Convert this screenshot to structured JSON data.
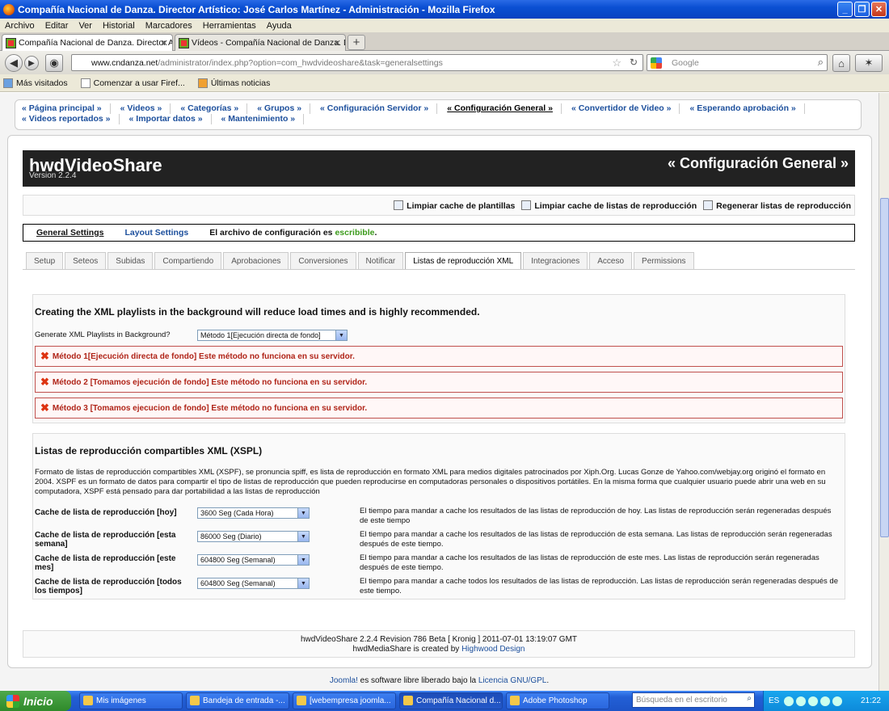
{
  "window": {
    "title": "Compañía Nacional de Danza. Director Artístico: José Carlos Martínez - Administración - Mozilla Firefox",
    "min_label": "_",
    "max_label": "❐",
    "close_label": "✕"
  },
  "menubar": [
    "Archivo",
    "Editar",
    "Ver",
    "Historial",
    "Marcadores",
    "Herramientas",
    "Ayuda"
  ],
  "browser_tabs": [
    {
      "label": "Compañía Nacional de Danza. Director Ar...",
      "close": "✕"
    },
    {
      "label": "Vídeos - Compañía Nacional de Danza. Di...",
      "close": "✕"
    }
  ],
  "new_tab_label": "+",
  "nav": {
    "url_domain": "www.cndanza.net",
    "url_path": "/administrator/index.php?option=com_hwdvideoshare&task=generalsettings",
    "search_placeholder": "Google"
  },
  "bookmarks": [
    "Más visitados",
    "Comenzar a usar Firef...",
    "Últimas noticias"
  ],
  "submenu": [
    "« Página principal »",
    "« Videos »",
    "« Categorías »",
    "« Grupos »",
    "« Configuración Servidor »",
    "« Configuración General »",
    "« Convertidor de Video »",
    "« Esperando aprobación »",
    "« Videos reportados »",
    "« Importar datos »",
    "« Mantenimiento »"
  ],
  "header": {
    "logo": "hwdVideoShare",
    "version": "Version 2.2.4",
    "title": "« Configuración General »"
  },
  "toolbar": {
    "clear_templates": "Limpiar cache de plantillas",
    "clear_playlists": "Limpiar cache de listas de reproducción",
    "regen_playlists": "Regenerar listas de reproducción"
  },
  "settings_bar": {
    "general": "General Settings",
    "layout": "Layout Settings",
    "config_text": "El archivo de configuración es",
    "writable": "escribible",
    "period": "."
  },
  "content_tabs": [
    "Setup",
    "Seteos",
    "Subidas",
    "Compartiendo",
    "Aprobaciones",
    "Conversiones",
    "Notificar",
    "Listas de reproducción XML",
    "Integraciones",
    "Acceso",
    "Permissions"
  ],
  "section1": {
    "heading": "Creating the XML playlists in the background will reduce load times and is highly recommended.",
    "label": "Generate XML Playlists in Background?",
    "select_value": "Método 1[Ejecución directa de fondo]",
    "errors": [
      "Método 1[Ejecución directa de fondo] Este método no funciona en su servidor.",
      "Método 2 [Tomamos ejecución de fondo] Este método no funciona en su servidor.",
      "Método 3 [Tomamos ejecucion de fondo] Este método no funciona en su servidor."
    ]
  },
  "section2": {
    "heading": "Listas de reproducción compartibles XML (XSPL)",
    "description": "Formato de listas de reproducción compartibles XML (XSPF), se pronuncia spiff, es lista de reproducción en formato XML para medios digitales patrocinados por Xiph.Org. Lucas Gonze de Yahoo.com/webjay.org originó el formato en 2004. XSPF es un formato de datos para compartir el tipo de listas de reproducción que pueden reproducirse en computadoras personales o dispositivos portátiles. En la misma forma que cualquier usuario puede abrir una web en su computadora, XSPF está pensado para dar portabilidad a las listas de reproducción",
    "rows": [
      {
        "label": "Cache de lista de reproducción [hoy]",
        "value": "3600 Seg (Cada Hora)",
        "help": "El tiempo para mandar a cache los resultados de las listas de reproducción de hoy. Las listas de reproducción serán regeneradas después de este tiempo"
      },
      {
        "label": "Cache de lista de reproducción [esta semana]",
        "value": "86000 Seg (Diario)",
        "help": "El tiempo para mandar a cache los resultados de las listas de reproducción de esta semana. Las listas de reproducción serán regeneradas después de este tiempo."
      },
      {
        "label": "Cache de lista de reproducción [este mes]",
        "value": "604800 Seg (Semanal)",
        "help": "El tiempo para mandar a cache los resultados de las listas de reproducción de este mes. Las listas de reproducción serán regeneradas después de este tiempo."
      },
      {
        "label": "Cache de lista de reproducción [todos los tiempos]",
        "value": "604800 Seg (Semanal)",
        "help": "El tiempo para mandar a cache todos los resultados de las listas de reproducción. Las listas de reproducción serán regeneradas después de este tiempo."
      }
    ]
  },
  "footer": {
    "line1": "hwdVideoShare 2.2.4 Revision 786 Beta [ Kronig ] 2011-07-01 13:19:07 GMT",
    "line2_pre": "hwdMediaShare is created by",
    "line2_link": "Highwood Design"
  },
  "joomla": {
    "link1": "Joomla!",
    "text": "es software libre liberado bajo la",
    "link2": "Licencia GNU/GPL",
    "period": "."
  },
  "taskbar": {
    "start": "Inicio",
    "tasks": [
      "Mis imágenes",
      "Bandeja de entrada -...",
      "[webempresa joomla...",
      "Compañía Nacional d...",
      "Adobe Photoshop"
    ],
    "search_placeholder": "Búsqueda en el escritorio",
    "lang": "ES",
    "clock": "21:22"
  }
}
